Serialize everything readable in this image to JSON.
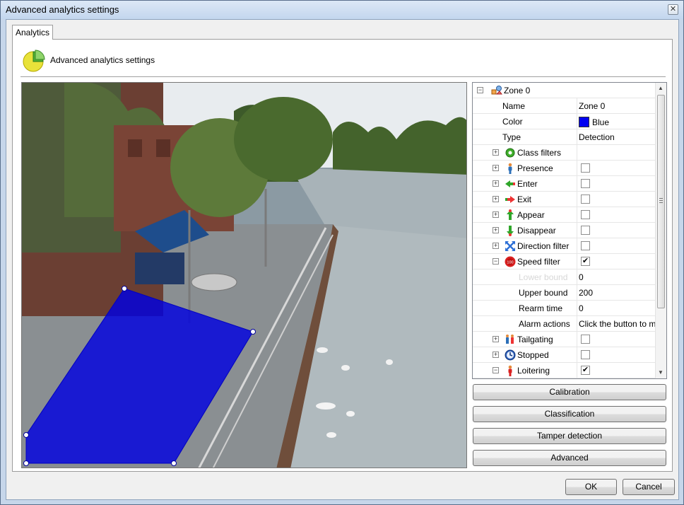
{
  "window": {
    "title": "Advanced analytics settings",
    "close_glyph": "✕"
  },
  "tabs": [
    {
      "label": "Analytics"
    }
  ],
  "header": {
    "text": "Advanced analytics settings",
    "icon": "pie-chart-icon"
  },
  "zone_overlay": {
    "color": "#0000e0",
    "opacity": 0.82
  },
  "tree": {
    "root": {
      "label": "Zone 0",
      "icon": "zone-icon",
      "expander": "−"
    },
    "rows": [
      {
        "label": "Name",
        "value": "Zone 0"
      },
      {
        "label": "Color",
        "value": "Blue",
        "swatch": "#0000f0"
      },
      {
        "label": "Type",
        "value": "Detection"
      },
      {
        "label": "Class filters",
        "icon": "gear-icon",
        "expander": "+"
      },
      {
        "label": "Presence",
        "icon": "person-icon",
        "expander": "+",
        "checked": ""
      },
      {
        "label": "Enter",
        "icon": "enter-arrow-icon",
        "expander": "+",
        "checked": ""
      },
      {
        "label": "Exit",
        "icon": "exit-arrow-icon",
        "expander": "+",
        "checked": ""
      },
      {
        "label": "Appear",
        "icon": "appear-icon",
        "expander": "+",
        "checked": ""
      },
      {
        "label": "Disappear",
        "icon": "disappear-icon",
        "expander": "+",
        "checked": ""
      },
      {
        "label": "Direction filter",
        "icon": "direction-icon",
        "expander": "+",
        "checked": ""
      },
      {
        "label": "Speed filter",
        "icon": "speed-limit-icon",
        "icon_text": "100",
        "expander": "−",
        "checked": "✔"
      },
      {
        "label": "Lower bound",
        "value": "0"
      },
      {
        "label": "Upper bound",
        "value": "200"
      },
      {
        "label": "Rearm time",
        "value": "0"
      },
      {
        "label": "Alarm actions",
        "value": "Click the button to mod"
      },
      {
        "label": "Tailgating",
        "icon": "tailgating-icon",
        "expander": "+",
        "checked": ""
      },
      {
        "label": "Stopped",
        "icon": "clock-icon",
        "expander": "+",
        "checked": ""
      },
      {
        "label": "Loitering",
        "icon": "loiter-icon",
        "expander": "−",
        "checked": "✔"
      }
    ]
  },
  "buttons": {
    "calibration": "Calibration",
    "classification": "Classification",
    "tamper": "Tamper detection",
    "advanced": "Advanced",
    "ok": "OK",
    "cancel": "Cancel"
  }
}
